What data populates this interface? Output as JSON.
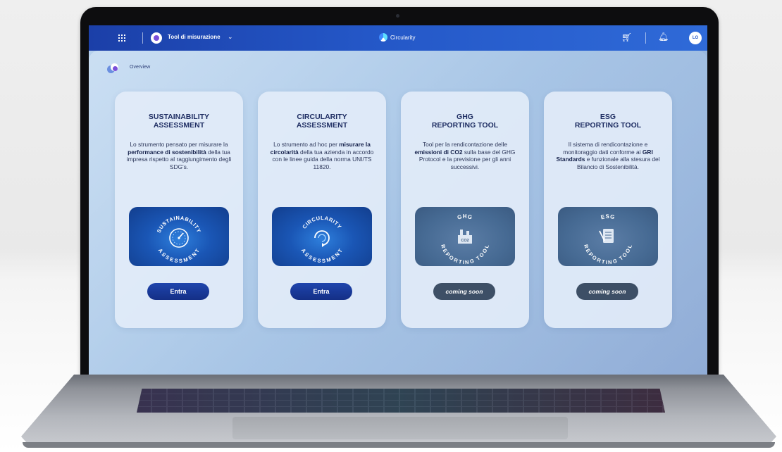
{
  "topbar": {
    "tool_menu_label": "Tool di misurazione",
    "brand_name": "Circularity",
    "avatar_initials": "LO"
  },
  "breadcrumb": {
    "label": "Overview"
  },
  "cards": [
    {
      "title_line1": "SUSTAINABILITY",
      "title_line2": "ASSESSMENT",
      "desc_parts": [
        "Lo strumento pensato per misurare la ",
        "performance di sostenibilità",
        " della tua impresa rispetto al raggiungimento degli SDG's."
      ],
      "badge": {
        "top": "SUSTAINABILITY",
        "bottom": "ASSESSMENT",
        "icon": "gauge-icon"
      },
      "button_label": "Entra"
    },
    {
      "title_line1": "CIRCULARITY",
      "title_line2": "ASSESSMENT",
      "desc_parts": [
        "Lo strumento ad hoc per ",
        "misurare la circolarità",
        " della tua azienda in accordo con le linee guida della norma UNI/TS 11820."
      ],
      "badge": {
        "top": "CIRCULARITY",
        "bottom": "ASSESSMENT",
        "icon": "circular-arrows-icon"
      },
      "button_label": "Entra"
    },
    {
      "title_line1": "GHG",
      "title_line2": "REPORTING TOOL",
      "desc_parts": [
        "Tool per la rendicontazione delle ",
        "emissioni di CO2",
        " sulla base del GHG Protocol e la previsione per gli anni successivi."
      ],
      "badge": {
        "top": "GHG",
        "bottom": "REPORTING TOOL",
        "icon": "co2-factory-icon",
        "inner_label": "CO2"
      },
      "button_label": "coming soon"
    },
    {
      "title_line1": "ESG",
      "title_line2": "REPORTING TOOL",
      "desc_parts": [
        "Il sistema di rendicontazione e monitoraggio dati conforme ai ",
        "GRI Standards",
        " e funzionale alla stesura del Bilancio di Sostenibilità."
      ],
      "badge": {
        "top": "ESG",
        "bottom": "REPORTING TOOL",
        "icon": "checklist-icon"
      },
      "button_label": "coming soon"
    }
  ],
  "colors": {
    "topbar": "#2457c7",
    "title": "#1f2e63",
    "enter_button": "#1a3b9c",
    "soon_button": "#3d4f66",
    "badge_blue": "#1a56b5",
    "badge_slate": "#466a93"
  }
}
